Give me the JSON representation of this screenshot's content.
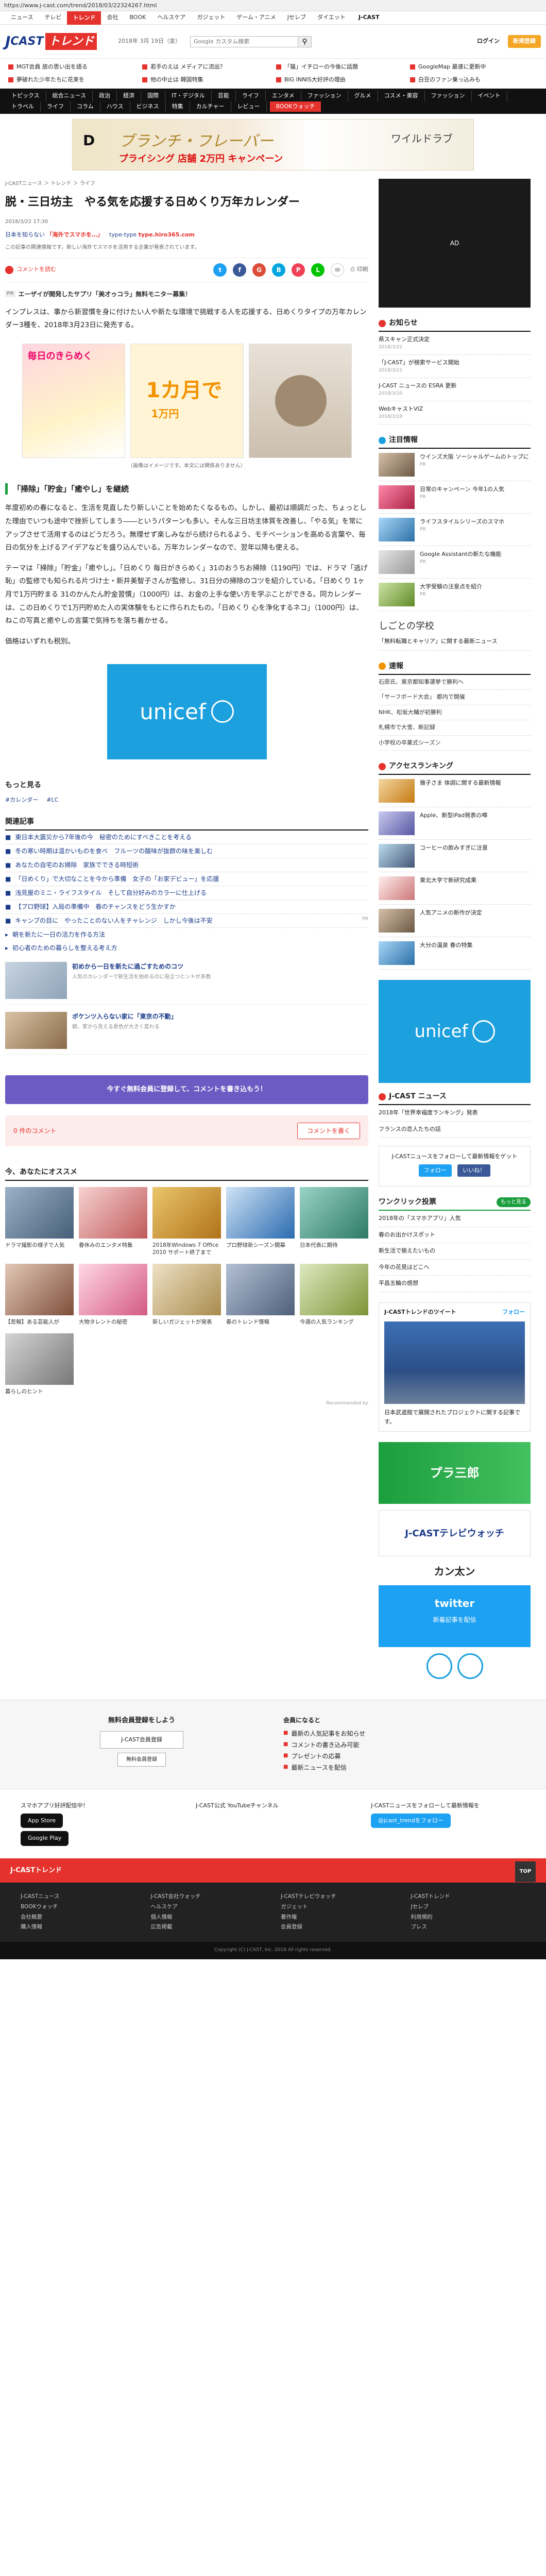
{
  "url": "https://www.j-cast.com/trend/2018/03/22324267.html",
  "topnav": {
    "items": [
      "ニュース",
      "テレビ",
      "トレンド",
      "会社",
      "BOOK",
      "ヘルスケア",
      "ガジェット",
      "ゲーム・アニメ",
      "Jセレブ",
      "ダイエット"
    ],
    "active": "トレンド",
    "brand": "J-CAST"
  },
  "header": {
    "logo_j": "J",
    "logo_cast": "CAST",
    "logo_trend": "トレンド",
    "date": "2018年 3月 19日（金）",
    "search_placeholder": "Google カスタム検索",
    "login": "ログイン",
    "register": "新規登録"
  },
  "trending": [
    "MGT会員 旅の思い出を語る",
    "若手のえは メディアに流出？",
    "「猫」イチローの今後に話題",
    "GoogleMap 最速に更新中",
    "夢破れた少年たちに花束を",
    "他の中止は 韓国特集",
    "BIG INNIS大好評の理由",
    "白豆のファン乗っ込みも"
  ],
  "cats": [
    "トピックス",
    "総合ニュース",
    "政治",
    "経済",
    "国際",
    "IT・デジタル",
    "芸能",
    "ライフ",
    "エンタメ",
    "ファッション",
    "グルメ",
    "コスメ・美容",
    "ファッション",
    "イベント",
    "トラベル",
    "ライフ",
    "コラム",
    "ハウス",
    "ビジネス",
    "特集",
    "カルチャー",
    "レビュー",
    "BOOKウォッチ"
  ],
  "banner": {
    "brand": "D",
    "text_main": "ブランチ・フレーバー",
    "text_sub": "ワイルドラブ",
    "text_bottom": "プライシング 店舗 2万円 キャンペーン"
  },
  "breadcrumb": "J-CASTニュース ＞ トレンド ＞ ライフ",
  "article": {
    "title": "脱・三日坊主　やる気を応援する日めくり万年カレンダー",
    "pubdate": "2018/3/22 17:30",
    "keywords": [
      {
        "label": "日本を知らない",
        "red": "「海外でスマホを…」"
      },
      {
        "label": "type-type",
        "red": "type.hiro365.com"
      }
    ],
    "sponsor": "この記事の関連情報です。新しい海外でスマホを活用する企業が発表されています。",
    "share_count_label": "コメントを読む",
    "share": [
      "t",
      "f",
      "G",
      "B",
      "P",
      "L",
      "✉"
    ],
    "print_label": "印刷",
    "adline": "エーザイが開発したサプリ「美才ゥコラ」無料モニター募集！",
    "p1": "インプレスは、事から新習慣を身に付けたい人や新たな環境で挑戦する人を応援する、日めくりタイプの万年カレンダー3種を、2018年3月23日に発売する。",
    "fig_a": "毎日のきらめく",
    "fig_b_big": "1カ月で",
    "fig_b_big2": "1万円",
    "caption": "（画像はイメージです。本文には関係ありません）",
    "h2": "「掃除」「貯金」「癒やし」を継続",
    "p2": "年度初めの春になると、生活を見直したり新しいことを始めたくなるもの。しかし、最初は順調だった、ちょっとした理由でいつも途中で挫折してしまう――というパターンも多い。そんな三日坊主体質を改善し、「やる気」を常にアップさせて活用するのはどうだろう。無理せず楽しみながら続けられるよう、モチベーションを高める言葉や、毎日の気分を上げるアイデアなどを盛り込んでいる。万年カレンダーなので、翌年以降も使える。",
    "p3": "テーマは「掃除」「貯金」「癒やし」。「日めくり 毎日がきらめく」31のおうちお掃除（1190円）では、ドラマ「逃げ恥」の監修でも知られる片づけ士・新井美智子さんが監修し、31日分の掃除のコツを紹介している。「日めくり 1ヶ月で1万円貯まる 31のかんたん貯金習慣」（1000円）は、お金の上手な使い方を学ぶことができる。同カレンダーは、この日めくりで1万円貯めた人の実体験をもとに作られたもの。「日めくり 心を浄化するネコ」（1000円）は、ねこの写真と癒やしの言葉で気持ちを落ち着かせる。",
    "p4": "価格はいずれも税別。",
    "unicef": "unicef",
    "more": "もっと見る",
    "tags": [
      "#カレンダー",
      "#LC"
    ]
  },
  "related": {
    "title": "関連記事",
    "items": [
      "東日本大震災から7年後の今　秘密のためにすべきことを考える",
      "冬の寒い時期は温かいものを食べ　フルーツの酸味が抜群の味を楽しむ",
      "あなたの自宅のお掃除　家族でできる時短術",
      "「日めくり」で大切なことを今から準備　女子の「お家デビュー」を応援",
      "浅見屋のミニ・ライフスタイル　そして自分好みのカラーに仕上げる",
      "【プロ野球】入局の準備中　春のチャンスをどう生かすか",
      "キャンプの目に　やったことのない人をチャレンジ　しかし今後は不安"
    ],
    "pr": "PR",
    "extra": [
      "朝を新たに一日の活力を作る方法",
      "初心者のための暮らしを整える考え方"
    ],
    "thumb1_title": "初めから一日を新たに過ごすためのコツ",
    "thumb1_sub": "人気のカレンダーで新生活を始めるのに役立つヒントが多数",
    "thumb2_title": "ボケンツ入らない家に「東京の不動」",
    "thumb2_sub": "朝、家から見える景色が大きく変わる"
  },
  "cta": "今すぐ無料会員に登録して、コメントを書き込もう！",
  "comment": {
    "count": "0 件のコメント",
    "button": "コメントを書く"
  },
  "recommend": {
    "title": "今、あなたにオススメ",
    "items": [
      "ドラマ撮影の様子で人気",
      "春休みのエンタメ特集",
      "2018年Windows 7 Office 2010 サポート終了まで",
      "プロ野球新シーズン開幕",
      "日本代表に期待",
      "【悲報】ある芸能人が",
      "大物タレントの秘密",
      "新しいガジェットが発表",
      "春のトレンド情報",
      "今週の人気ランキング",
      "暮らしのヒント"
    ],
    "footer": "Recommended by"
  },
  "side": {
    "ad": "AD",
    "news_title": "お知らせ",
    "news": [
      {
        "t": "県スキャン正式決定",
        "d": "2018/3/22"
      },
      {
        "t": "「J-CAST」が検索サービス開始",
        "d": "2018/3/21"
      },
      {
        "t": "J-CAST ニュースの ESRA 更新",
        "d": "2018/3/20"
      },
      {
        "t": "WebキャストVIZ",
        "d": "2018/3/19"
      }
    ],
    "rank_title": "注目情報",
    "rank": [
      {
        "t": "ウインズ大阪 ソーシャルゲームのトップに",
        "d": "PR"
      },
      {
        "t": "日常のキャンペーン 今年1の人気",
        "d": "PR"
      },
      {
        "t": "ライフスタイルシリーズのスマホ",
        "d": "PR"
      },
      {
        "t": "Google Assistantの新たな機能",
        "d": "PR"
      },
      {
        "t": "大学受験の注意点を紹介",
        "d": "PR"
      }
    ],
    "shikoto": "しごとの学校",
    "shikoto_item": "「無料転職とキャリア」に関する最新ニュース",
    "hot_title": "速報",
    "hot": [
      "石原氏、東京都知事選挙で勝利へ",
      "「サーフボード大会」 都内で開催",
      "NHK、松坂大輔が初勝利",
      "札幌市で大雪、新記録",
      "小学校の卒業式シーズン"
    ],
    "ranking_title": "アクセスランキング",
    "ranking": [
      "雅子さま 体調に関する最新情報",
      "Apple、新型iPad発表の噂",
      "コーヒーの飲みすぎに注意",
      "東北大学で新研究成果",
      "人気アニメの新作が決定",
      "大分の温泉 春の特集"
    ],
    "unicef": "unicef",
    "j_title": "J-CAST ニュース",
    "j_items": [
      "2018年「世界幸福度ランキング」発表",
      "フランスの恋人たちの話"
    ],
    "follow": "J-CASTニュースをフォローして最新情報をゲット",
    "follow_tw": "フォロー",
    "follow_fb": "いいね！",
    "wrank_title": "ワンクリック投票",
    "wrank_more": "もっと見る",
    "wrank": [
      "2018年の「スマホアプリ」人気",
      "春のお出かけスポット",
      "新生活で揃えたいもの",
      "今年の花見はどこへ",
      "平昌五輪の感想"
    ],
    "tweet_title": "J-CASTトレンドのツイート",
    "tweet_follow": "フォロー",
    "tweet_text": "日本武道館で展開されたプロジェクトに関する記事です。",
    "ad1": "プラ三郎",
    "ad2": "J-CASTテレビウォッチ",
    "kantoban": "カン太ン",
    "twitter_tile": "twitter",
    "twitter_sub": "新着記事を配信"
  },
  "members": {
    "free_title": "無料会員登録をしよう",
    "free_btn": "J-CAST会員登録",
    "free_btn2": "無料会員登録",
    "member_title": "会員になると",
    "benefits": [
      "最新の人気記事をお知らせ",
      "コメントの書き込み可能",
      "プレゼントの応募",
      "最新ニュースを配信"
    ]
  },
  "apps": {
    "c1": "スマホアプリ好評配信中！",
    "c1_a": "App Store",
    "c1_b": "Google Play",
    "c2": "J-CAST公式 YouTubeチャンネル",
    "c3": "J-CASTニュースをフォローして最新情報を",
    "c3_btn": "@jcast_trendをフォロー"
  },
  "footer": {
    "brand": "J-CASTトレンド",
    "top": "TOP",
    "links": [
      "J-CASTニュース",
      "J-CAST会社ウォッチ",
      "J-CASTテレビウォッチ",
      "J-CASTトレンド",
      "BOOKウォッチ",
      "ヘルスケア",
      "ガジェット",
      "Jセレブ",
      "会社概要",
      "個人情報",
      "著作権",
      "利用規約",
      "購入情報",
      "広告掲載",
      "会員登録",
      "プレス"
    ],
    "copy": "Copyright (C) J-CAST, Inc. 2018 All rights reserved."
  }
}
